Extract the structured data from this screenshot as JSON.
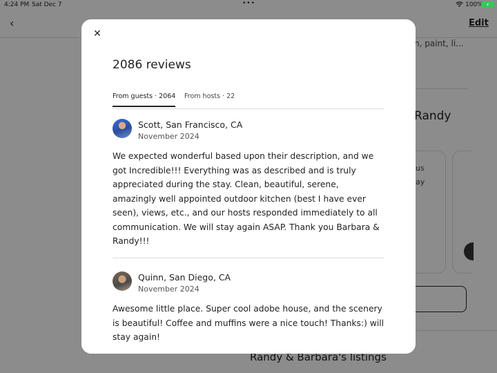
{
  "status_bar": {
    "time": "4:24 PM",
    "date": "Sat Dec 7",
    "battery_pct": "100%"
  },
  "background": {
    "edit_label": "Edit",
    "amenities_snippet": "n, paint, li...",
    "host_heading_snippet": "Randy",
    "card_line1": "us",
    "card_line2": "ay",
    "listings_heading": "Randy & Barbara's listings"
  },
  "modal": {
    "title": "2086 reviews",
    "tabs": [
      {
        "label": "From guests · 2064",
        "active": true
      },
      {
        "label": "From hosts · 22",
        "active": false
      }
    ],
    "reviews": [
      {
        "name": "Scott, San Francisco, CA",
        "date": "November 2024",
        "text": "We expected wonderful based upon their description, and we got Incredible!!! Everything was as described and is truly appreciated during the stay. Clean, beautiful, serene, amazingly well appointed outdoor kitchen (best I have ever seen), views, etc., and our hosts responded immediately to all communication. We will stay again ASAP. Thank you Barbara & Randy!!!"
      },
      {
        "name": "Quinn, San Diego, CA",
        "date": "November 2024",
        "text": "Awesome little place. Super cool adobe house, and the scenery is beautiful! Coffee and muffins were a nice touch! Thanks:) will stay again!"
      }
    ]
  }
}
